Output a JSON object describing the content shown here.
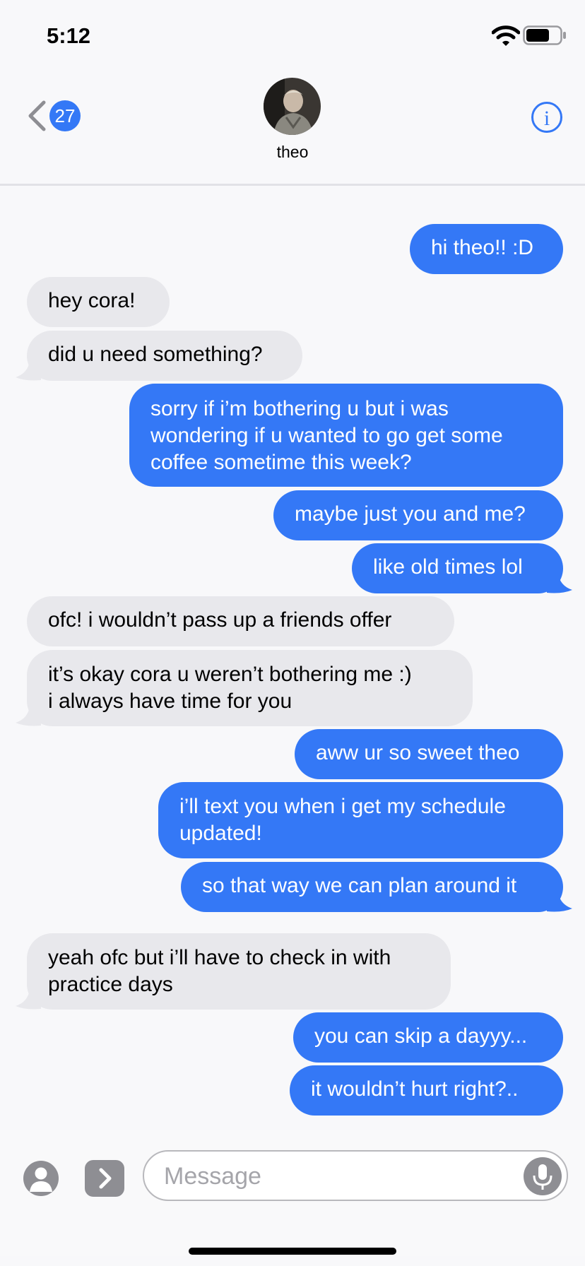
{
  "status_bar": {
    "time": "5:12"
  },
  "header": {
    "back_count": "27",
    "contact_name": "theo"
  },
  "messages": [
    {
      "text": "hi theo!! :D"
    },
    {
      "text": "hey cora!"
    },
    {
      "text": "did u need something?"
    },
    {
      "text": "sorry if i’m bothering u but i was wondering if u wanted to go get some coffee sometime this week?"
    },
    {
      "text": "maybe just you and me?"
    },
    {
      "text": "like old times lol"
    },
    {
      "text": "ofc! i wouldn’t pass up a friends offer"
    },
    {
      "text": "it’s okay cora u weren’t bothering me :)\ni always have time for you"
    },
    {
      "text": "aww ur so sweet theo"
    },
    {
      "text": "i’ll text you when i get my schedule updated!"
    },
    {
      "text": "so that way we can plan around it"
    },
    {
      "text": "yeah ofc but i’ll have to check in with practice days"
    },
    {
      "text": "you can skip a dayyy..."
    },
    {
      "text": "it wouldn’t hurt right?.."
    }
  ],
  "composer": {
    "placeholder": "Message"
  },
  "colors": {
    "sent_bubble": "#3478f6",
    "received_bubble": "#e8e8ec",
    "accent": "#3478f6"
  }
}
